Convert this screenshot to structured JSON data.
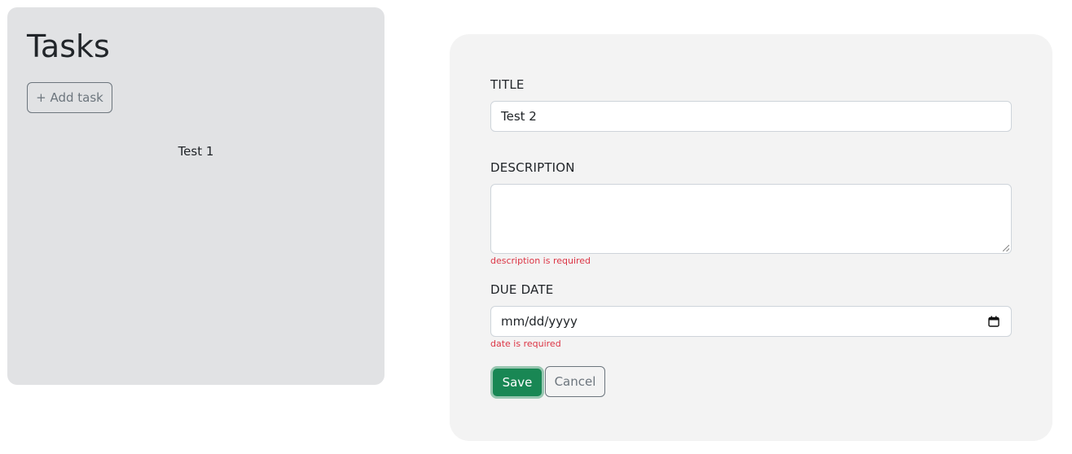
{
  "tasks_panel": {
    "title": "Tasks",
    "add_button_label": "+ Add task",
    "items": [
      {
        "label": "Test 1"
      }
    ]
  },
  "form": {
    "title_label": "TITLE",
    "title_value": "Test 2",
    "description_label": "DESCRIPTION",
    "description_value": "",
    "description_error": "description is required",
    "due_date_label": "DUE DATE",
    "due_date_placeholder": "mm/dd/yyyy",
    "due_date_icon": "calendar-icon",
    "due_date_error": "date is required",
    "save_label": "Save",
    "cancel_label": "Cancel"
  },
  "colors": {
    "panel_bg": "#e1e2e4",
    "form_bg": "#f3f3f3",
    "save_green": "#198754",
    "secondary_gray": "#6c757d",
    "error_red": "#dc3545"
  }
}
